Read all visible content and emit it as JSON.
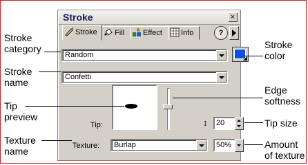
{
  "panel": {
    "title": "Stroke",
    "close_glyph": "×",
    "tabs": [
      {
        "label": "Stroke",
        "icon": "brush-icon"
      },
      {
        "label": "Fill",
        "icon": "fill-bucket-icon"
      },
      {
        "label": "Effect",
        "icon": "effect-icon"
      },
      {
        "label": "Info",
        "icon": "info-grid-icon"
      }
    ],
    "help_glyph": "?",
    "stroke_category": "Random",
    "stroke_name": "Confetti",
    "tip_label": "Tip:",
    "tip_size": "20",
    "texture_label": "Texture:",
    "texture_name": "Burlap",
    "texture_amount": "50%",
    "stroke_color": "#0a4fe0"
  },
  "callouts": {
    "stroke_category": [
      "Stroke",
      "category"
    ],
    "stroke_name": [
      "Stroke",
      "name"
    ],
    "tip_preview": [
      "Tip",
      "preview"
    ],
    "texture_name": [
      "Texture",
      "name"
    ],
    "stroke_color": [
      "Stroke",
      "color"
    ],
    "edge_softness": [
      "Edge",
      "softness"
    ],
    "tip_size": [
      "Tip size"
    ],
    "amount_texture": [
      "Amount",
      "of texture"
    ]
  }
}
